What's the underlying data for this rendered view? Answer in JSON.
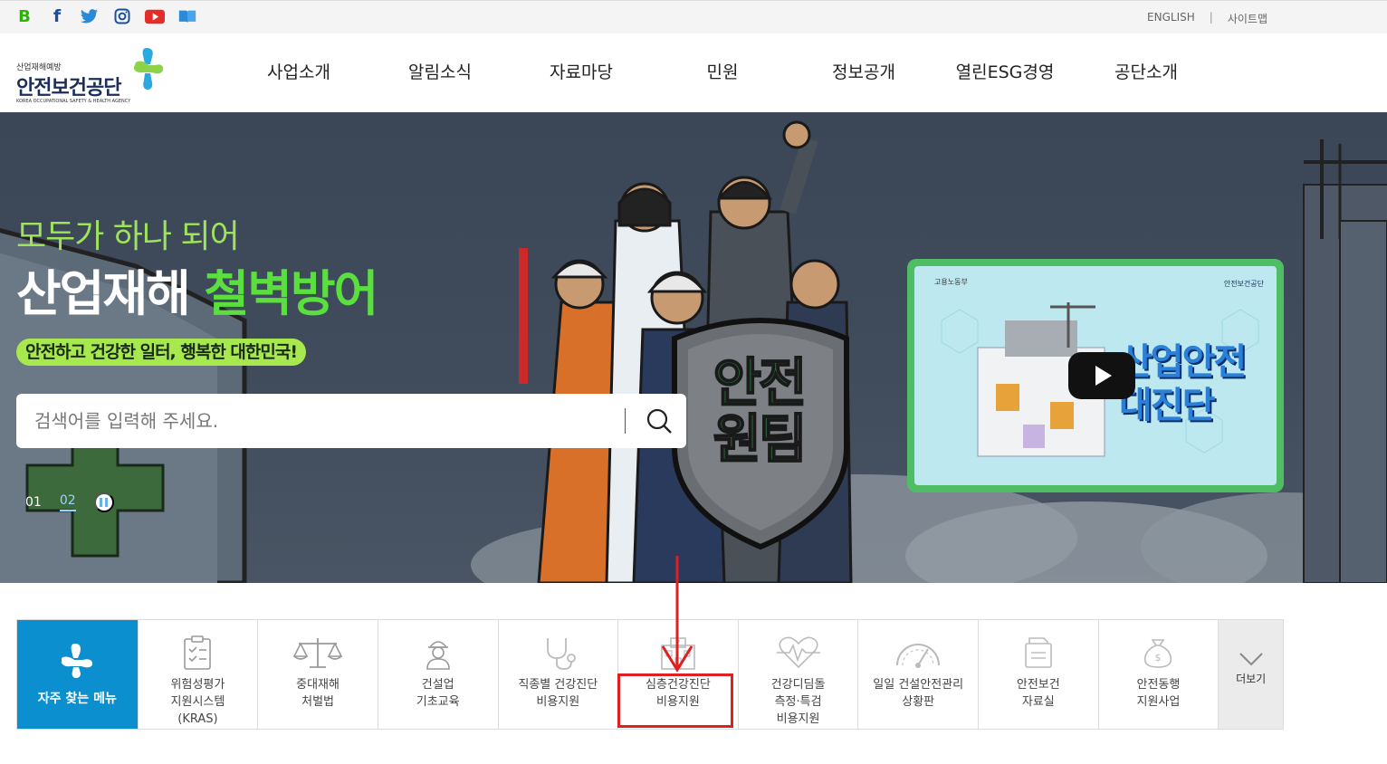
{
  "social": {
    "blog_glyph": "B",
    "facebook_glyph": "f",
    "icons": [
      "blog-icon",
      "facebook-icon",
      "twitter-icon",
      "instagram-icon",
      "youtube-icon",
      "book-icon"
    ]
  },
  "util": {
    "english": "ENGLISH",
    "separator": "|",
    "sitemap": "사이트맵"
  },
  "logo": {
    "sub": "산업재해예방",
    "main": "안전보건공단",
    "en": "KOREA OCCUPATIONAL SAFETY & HEALTH AGENCY"
  },
  "gnb": [
    "사업소개",
    "알림소식",
    "자료마당",
    "민원",
    "정보공개",
    "열린ESG경영",
    "공단소개"
  ],
  "hero": {
    "line1": "모두가 하나 되어",
    "line2_white": "산업재해 ",
    "line2_green": "철벽방어",
    "pill": "안전하고 건강한 일터, 행복한 대한민국!",
    "shield_text": "안전\n원팀"
  },
  "search": {
    "placeholder": "검색어를 입력해 주세요."
  },
  "pager": {
    "slide1": "01",
    "slide2": "02"
  },
  "video": {
    "ministry": "고용노동부",
    "agency": "안전보건공단",
    "title": "산업안전\n대진단"
  },
  "quick_menu": {
    "header": "자주 찾는 메뉴",
    "items": [
      {
        "label": "위험성평가\n지원시스템\n(KRAS)",
        "icon": "checklist-icon"
      },
      {
        "label": "중대재해\n처벌법",
        "icon": "scales-icon"
      },
      {
        "label": "건설업\n기초교육",
        "icon": "worker-icon"
      },
      {
        "label": "직종별 건강진단\n비용지원",
        "icon": "stethoscope-icon"
      },
      {
        "label": "심층건강진단\n비용지원",
        "icon": "hospital-icon"
      },
      {
        "label": "건강디딤돌\n측정·특검\n비용지원",
        "icon": "heartbeat-icon"
      },
      {
        "label": "일일 건설안전관리\n상황판",
        "icon": "gauge-icon"
      },
      {
        "label": "안전보건\n자료실",
        "icon": "folder-icon"
      },
      {
        "label": "안전동행\n지원사업",
        "icon": "money-bag-icon"
      }
    ],
    "more": "더보기"
  },
  "colors": {
    "accent_blue": "#0b8fcf",
    "hero_green": "#5bdf3f",
    "annotation_red": "#e02020"
  }
}
